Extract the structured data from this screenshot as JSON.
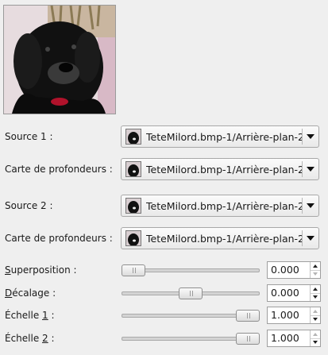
{
  "preview": {
    "icon": "dog-photo-preview"
  },
  "rows": [
    {
      "label": "Source 1 :",
      "value": "TeteMilord.bmp-1/Arrière-plan-2"
    },
    {
      "label": "Carte de profondeurs :",
      "value": "TeteMilord.bmp-1/Arrière-plan-2"
    },
    {
      "label": "Source 2 :",
      "value": "TeteMilord.bmp-1/Arrière-plan-2"
    },
    {
      "label": "Carte de profondeurs :",
      "value": "TeteMilord.bmp-1/Arrière-plan-2"
    }
  ],
  "params": [
    {
      "mnemonic": "S",
      "rest": "uperposition :",
      "value": "0.000",
      "position": 0.0
    },
    {
      "mnemonic": "D",
      "rest": "écalage :",
      "value": "0.000",
      "position": 0.5
    },
    {
      "prefix": "Échelle ",
      "mnemonic": "1",
      "rest": " :",
      "value": "1.000",
      "position": 1.0
    },
    {
      "prefix": "Échelle ",
      "mnemonic": "2",
      "rest": " :",
      "value": "1.000",
      "position": 1.0
    }
  ],
  "colors": {
    "background": "#efefef",
    "accent": "#111111"
  }
}
